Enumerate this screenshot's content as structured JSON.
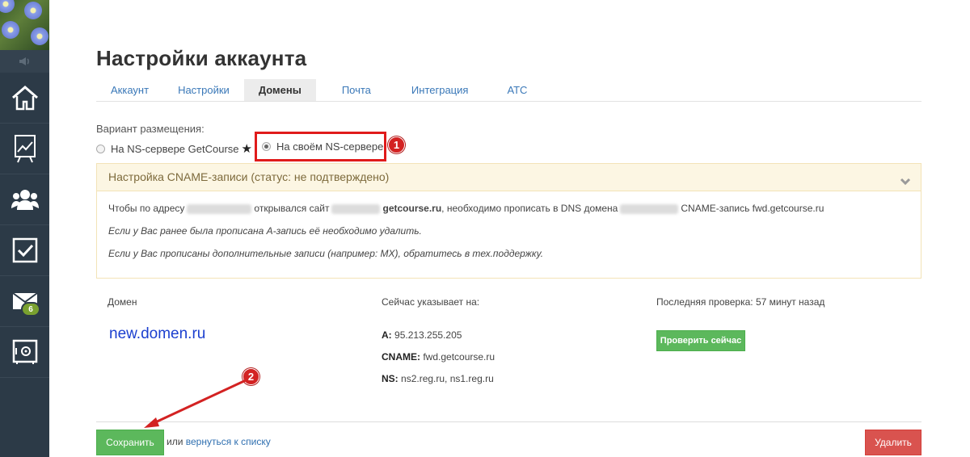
{
  "sidebar": {
    "items": [
      {
        "icon": "home-icon"
      },
      {
        "icon": "chart-board-icon"
      },
      {
        "icon": "users-icon"
      },
      {
        "icon": "tasks-checkbox-icon"
      },
      {
        "icon": "mail-icon",
        "badge": "6"
      },
      {
        "icon": "safe-icon"
      }
    ]
  },
  "page": {
    "title": "Настройки аккаунта"
  },
  "tabs": [
    {
      "label": "Аккаунт",
      "active": false
    },
    {
      "label": "Настройки",
      "active": false
    },
    {
      "label": "Домены",
      "active": true
    },
    {
      "label": "Почта",
      "active": false
    },
    {
      "label": "Интеграция",
      "active": false
    },
    {
      "label": "АТС",
      "active": false
    }
  ],
  "placement": {
    "label": "Вариант размещения:",
    "option_getcourse": "На NS-сервере GetCourse",
    "option_own": "На своём NS-сервере",
    "selected": "own"
  },
  "markers": {
    "one": "1",
    "two": "2"
  },
  "cname": {
    "header": "Настройка CNAME-записи (статус: не подтверждено)",
    "line1_a": "Чтобы по адресу",
    "line1_b": "открывался сайт",
    "line1_domain": "getcourse.ru",
    "line1_c": ", необходимо прописать в DNS домена",
    "line1_d": "CNAME-запись fwd.getcourse.ru",
    "line2": "Если у Вас ранее была прописана А-запись её необходимо удалить.",
    "line3": "Если у Вас прописаны дополнительные записи (например: MX), обратитесь в тех.поддержку."
  },
  "domain_table": {
    "col_domain": "Домен",
    "col_points": "Сейчас указывает на:",
    "col_check": "Последняя проверка: 57 минут назад",
    "domain": "new.domen.ru",
    "a_label": "A:",
    "a_value": "95.213.255.205",
    "cname_label": "CNAME:",
    "cname_value": "fwd.getcourse.ru",
    "ns_label": "NS:",
    "ns_value": "ns2.reg.ru, ns1.reg.ru",
    "check_button": "Проверить сейчас"
  },
  "footer": {
    "save_button": "Сохранить",
    "or_text": "или",
    "back_link": "вернуться к списку",
    "delete_button": "Удалить"
  },
  "colors": {
    "sidebar_bg": "#2c3a47",
    "link": "#3a78b8",
    "success": "#5cb85c",
    "danger": "#d9534f",
    "highlight": "#e01b1b"
  }
}
